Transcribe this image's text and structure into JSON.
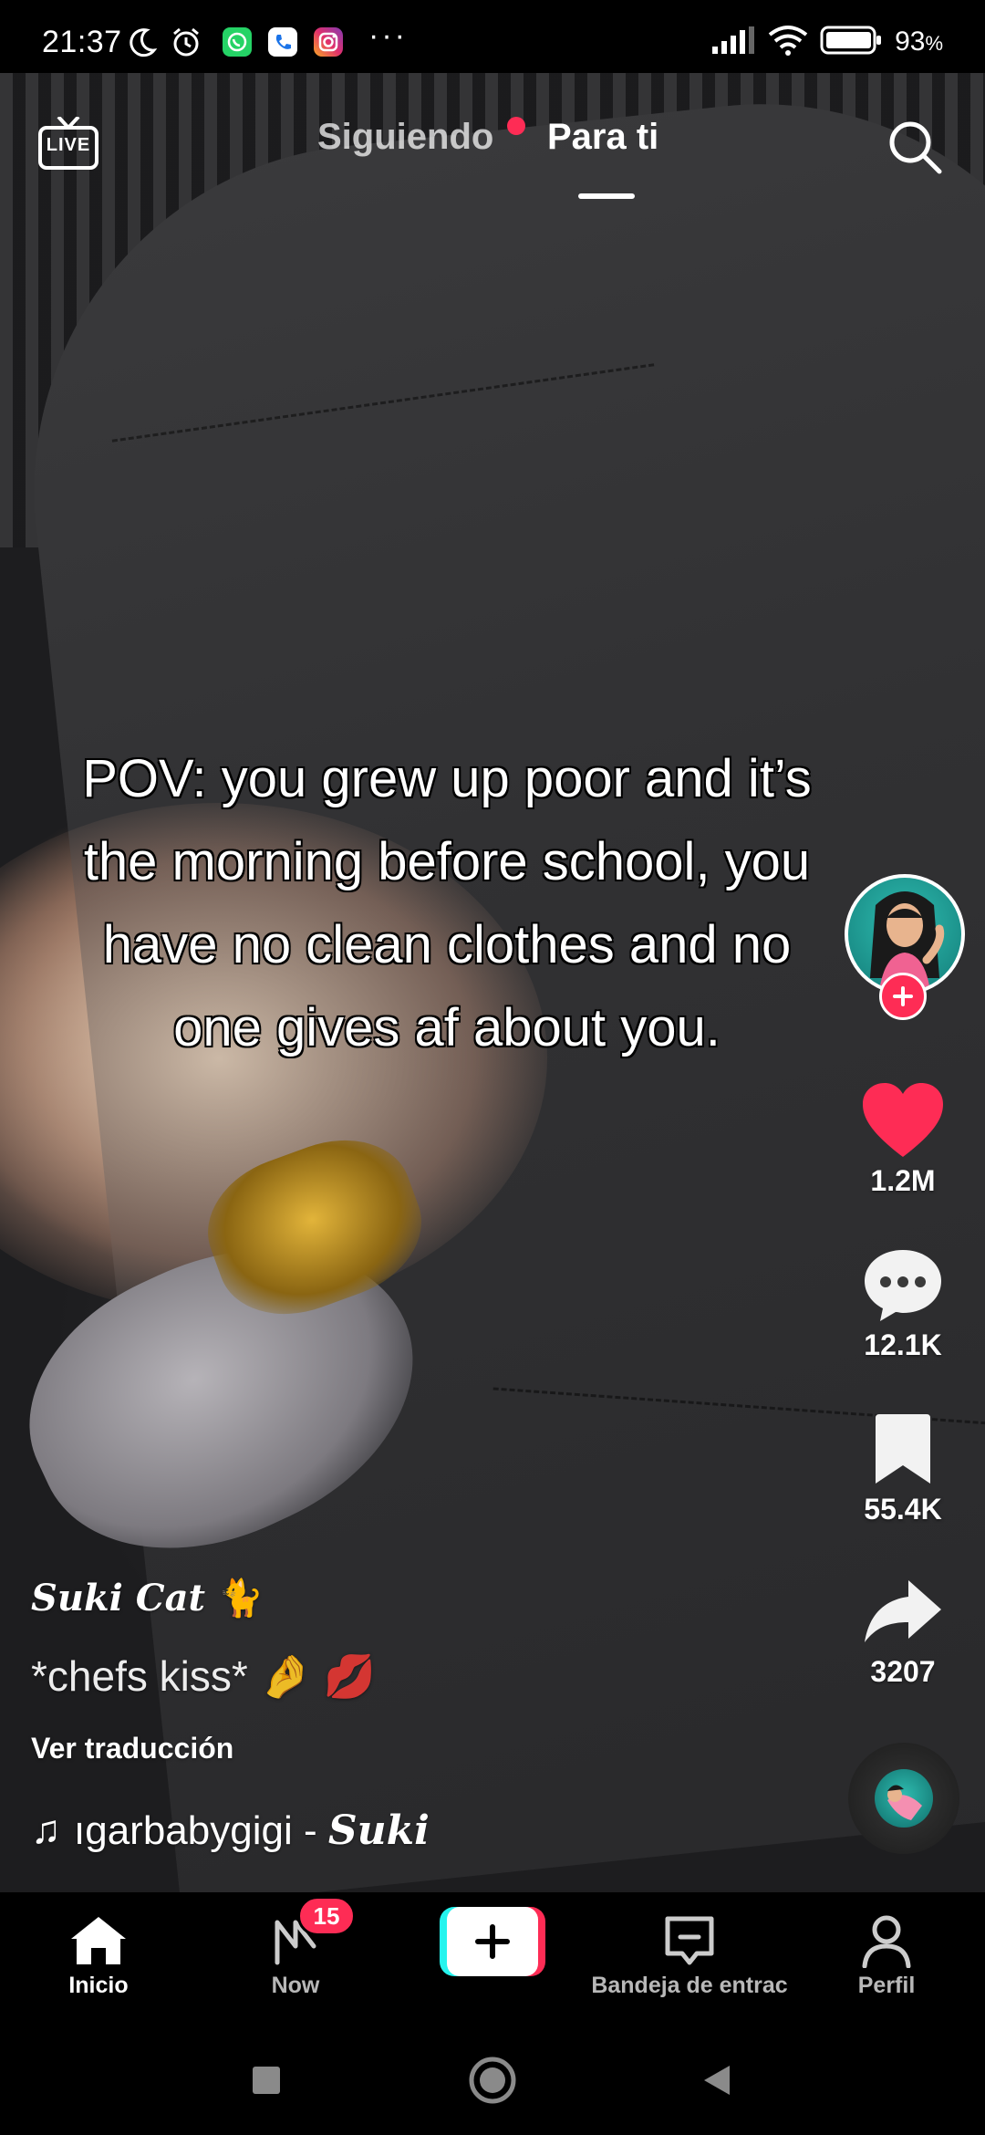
{
  "status_bar": {
    "time": "21:37",
    "battery_percent": "93",
    "battery_suffix": "%",
    "notification_icons": [
      "moon-icon",
      "alarm-icon",
      "whatsapp-icon",
      "phone-app-icon",
      "instagram-icon"
    ],
    "overflow": "···"
  },
  "top_nav": {
    "live_label": "LIVE",
    "tabs": [
      {
        "label": "Siguiendo",
        "active": false,
        "has_dot": true
      },
      {
        "label": "Para ti",
        "active": true
      }
    ]
  },
  "video": {
    "overlay_text": "POV: you grew up poor and it’s the morning before school, you have no clean clothes and no one gives af about you."
  },
  "right_rail": {
    "likes": "1.2M",
    "comments": "12.1K",
    "saves": "55.4K",
    "shares": "3207"
  },
  "caption": {
    "author": "Suki Cat",
    "author_emoji": "🐈",
    "description": "*chefs kiss*",
    "description_emojis": "🤌 💋",
    "translate_label": "Ver traducción",
    "music_note": "♫",
    "music_text": "ıgarbabygigi - ",
    "music_artist": "Suki"
  },
  "bottom_tabs": [
    {
      "label": "Inicio",
      "icon": "home-icon",
      "active": true
    },
    {
      "label": "Now",
      "icon": "now-icon",
      "badge": "15"
    },
    {
      "label": "",
      "icon": "plus-icon"
    },
    {
      "label": "Bandeja de entrac",
      "icon": "inbox-icon"
    },
    {
      "label": "Perfil",
      "icon": "profile-icon"
    }
  ],
  "colors": {
    "accent": "#fe2c55",
    "cyan": "#25f4ee",
    "background": "#000000"
  }
}
